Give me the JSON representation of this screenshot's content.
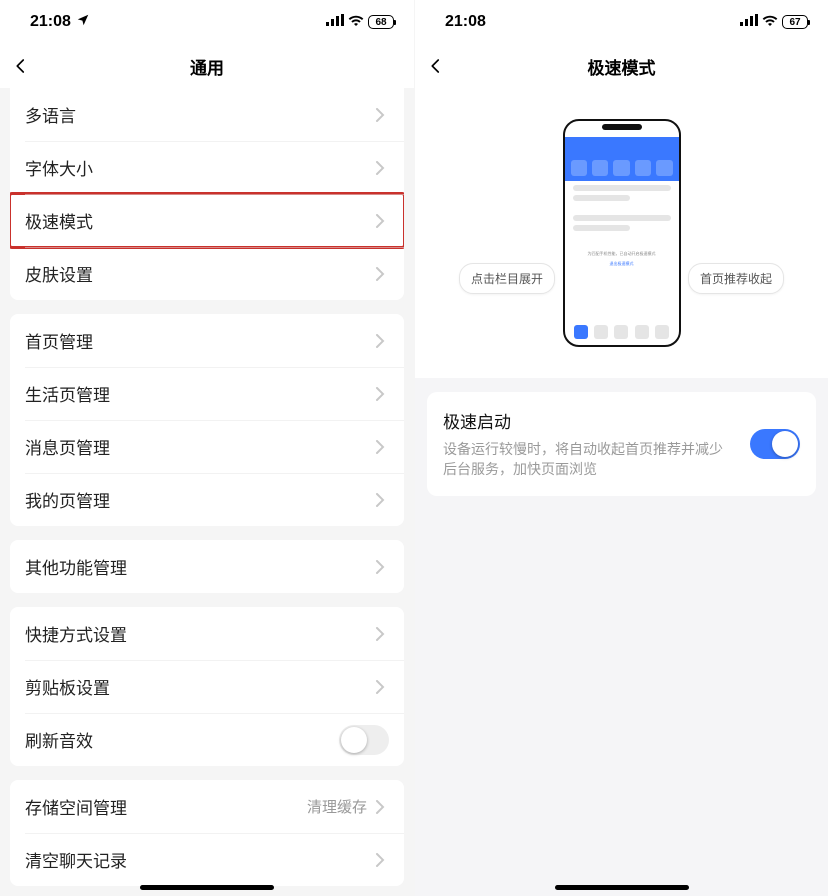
{
  "left": {
    "status": {
      "time": "21:08",
      "battery": "68"
    },
    "title": "通用",
    "groups": [
      [
        {
          "label": "多语言"
        },
        {
          "label": "字体大小"
        },
        {
          "label": "极速模式",
          "highlight": true
        },
        {
          "label": "皮肤设置"
        }
      ],
      [
        {
          "label": "首页管理"
        },
        {
          "label": "生活页管理"
        },
        {
          "label": "消息页管理"
        },
        {
          "label": "我的页管理"
        }
      ],
      [
        {
          "label": "其他功能管理"
        }
      ],
      [
        {
          "label": "快捷方式设置"
        },
        {
          "label": "剪贴板设置"
        },
        {
          "label": "刷新音效",
          "toggle": false
        }
      ],
      [
        {
          "label": "存储空间管理",
          "value": "清理缓存"
        },
        {
          "label": "清空聊天记录"
        }
      ]
    ]
  },
  "right": {
    "status": {
      "time": "21:08",
      "battery": "67"
    },
    "title": "极速模式",
    "pill_left": "点击栏目展开",
    "pill_right": "首页推荐收起",
    "ill_banner": "为匹配手机性能，已自动开启极速模式",
    "ill_link": "退出极速模式",
    "panel": {
      "title": "极速启动",
      "desc": "设备运行较慢时，将自动收起首页推荐并减少后台服务，加快页面浏览",
      "on": true
    }
  }
}
